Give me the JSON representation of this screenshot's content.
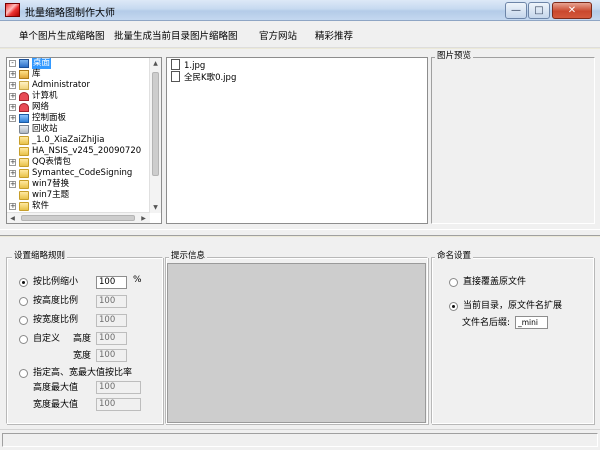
{
  "window": {
    "title": "批量缩略图制作大师"
  },
  "menu": [
    "单个图片生成缩略图",
    "批量生成当前目录图片缩略图",
    "官方网站",
    "精彩推荐"
  ],
  "tree": {
    "items": [
      {
        "label": "桌面",
        "icon": "desktop-icon",
        "selected": true,
        "expander": "-"
      },
      {
        "label": "库",
        "icon": "library-icon",
        "expander": "+"
      },
      {
        "label": "Administrator",
        "icon": "user-folder-icon",
        "expander": "+"
      },
      {
        "label": "计算机",
        "icon": "computer-icon",
        "expander": "+"
      },
      {
        "label": "网络",
        "icon": "network-icon",
        "expander": "+"
      },
      {
        "label": "控制面板",
        "icon": "control-panel-icon",
        "expander": "+"
      },
      {
        "label": "回收站",
        "icon": "recycle-bin-icon",
        "expander": ""
      },
      {
        "label": "_1.0_XiaZaiZhiJia",
        "icon": "folder-icon",
        "expander": ""
      },
      {
        "label": "HA_NSIS_v245_20090720",
        "icon": "folder-icon",
        "expander": ""
      },
      {
        "label": "QQ表情包",
        "icon": "folder-icon",
        "expander": "+"
      },
      {
        "label": "Symantec_CodeSigning",
        "icon": "folder-icon",
        "expander": "+"
      },
      {
        "label": "win7替换",
        "icon": "folder-icon",
        "expander": "+"
      },
      {
        "label": "win7主题",
        "icon": "folder-icon",
        "expander": ""
      },
      {
        "label": "软件",
        "icon": "folder-icon",
        "expander": "+"
      }
    ]
  },
  "files": [
    "1.jpg",
    "全民K歌0.jpg"
  ],
  "preview": {
    "title": "图片预览"
  },
  "rules": {
    "title": "设置缩略规则",
    "options": [
      {
        "label": "按比例缩小",
        "value": "100",
        "unit": "%",
        "checked": true
      },
      {
        "label": "按高度比例",
        "value": "100",
        "checked": false
      },
      {
        "label": "按宽度比例",
        "value": "100",
        "checked": false
      },
      {
        "label": "自定义",
        "sub1": "高度",
        "value1": "100",
        "sub2": "宽度",
        "value2": "100",
        "checked": false
      },
      {
        "label": "指定高、宽最大值按比率",
        "sub1": "高度最大值",
        "value1": "100",
        "sub2": "宽度最大值",
        "value2": "100",
        "checked": false
      }
    ]
  },
  "info": {
    "title": "提示信息"
  },
  "naming": {
    "title": "命名设置",
    "opt1": "直接覆盖原文件",
    "opt2": "当前目录，原文件名扩展",
    "suffix_label": "文件名后缀:",
    "suffix_value": "_mini",
    "selected": 2
  }
}
